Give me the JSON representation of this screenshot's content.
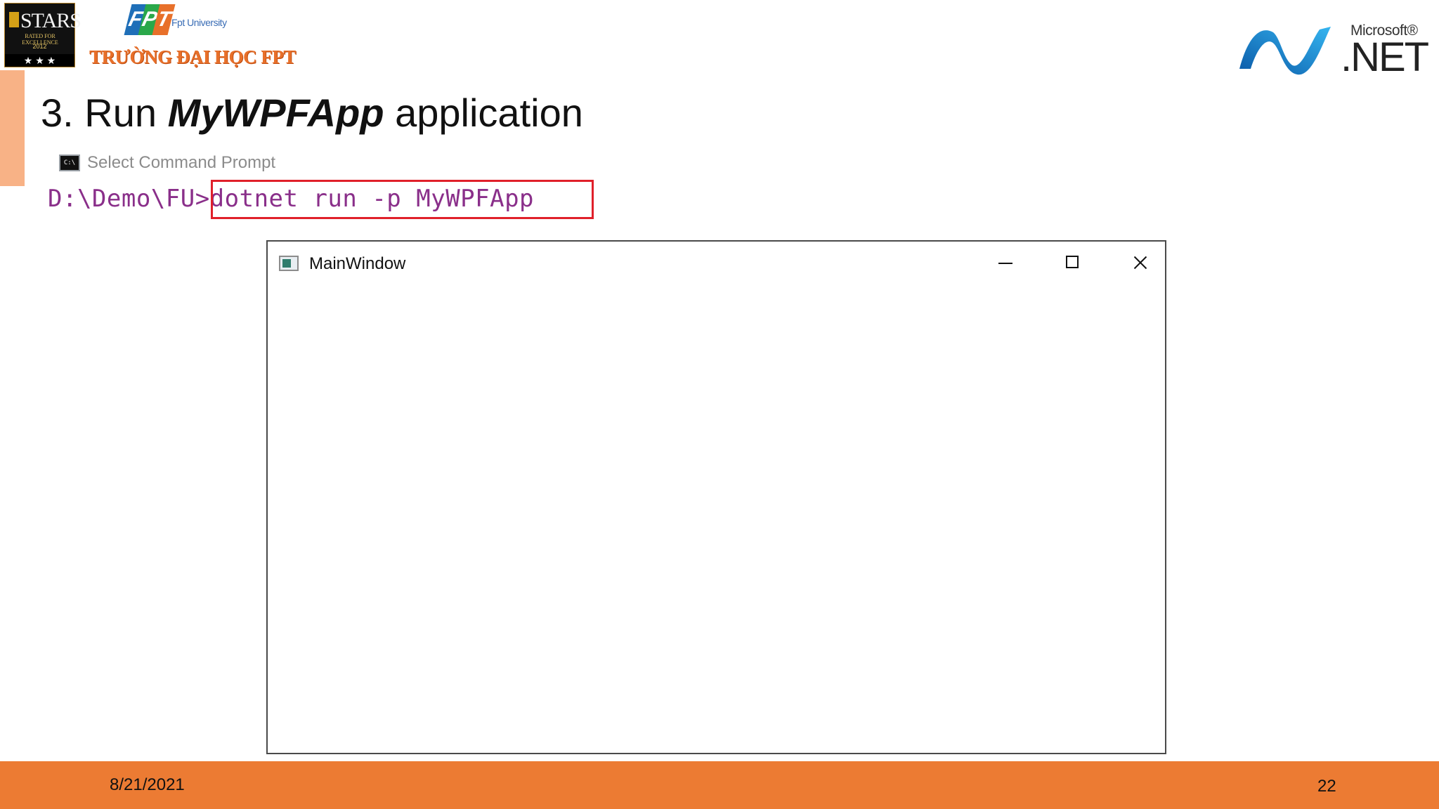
{
  "header": {
    "stars_logo": {
      "word": "STARS",
      "subtitle": "RATED FOR EXCELLENCE",
      "year": "2012",
      "dots": "★ ★ ★"
    },
    "fpt_logo": {
      "letters": [
        "F",
        "P",
        "T"
      ],
      "university": "Fpt University",
      "school_name": "TRƯỜNG ĐẠI HỌC FPT",
      "colors": [
        "#1f6fb8",
        "#2aa84a",
        "#e8702a"
      ]
    },
    "dotnet_logo": {
      "brand": "Microsoft®",
      "product": ".NET"
    }
  },
  "slide": {
    "title_prefix": "3. Run ",
    "title_emphasis": "MyWPFApp",
    "title_suffix": " application",
    "accent_color": "#f8b286"
  },
  "console": {
    "caption_icon": "C:\\",
    "caption": "Select Command Prompt",
    "prompt": "D:\\Demo\\FU>",
    "command": "dotnet run -p MyWPFApp",
    "text_color": "#8a2f8a",
    "highlight_color": "#e0202a"
  },
  "window": {
    "title": "MainWindow",
    "icon": "window-app-icon",
    "controls": [
      "minimize-icon",
      "maximize-icon",
      "close-icon"
    ]
  },
  "footer": {
    "date": "8/21/2021",
    "page_number": "22",
    "color": "#ec7b33"
  }
}
